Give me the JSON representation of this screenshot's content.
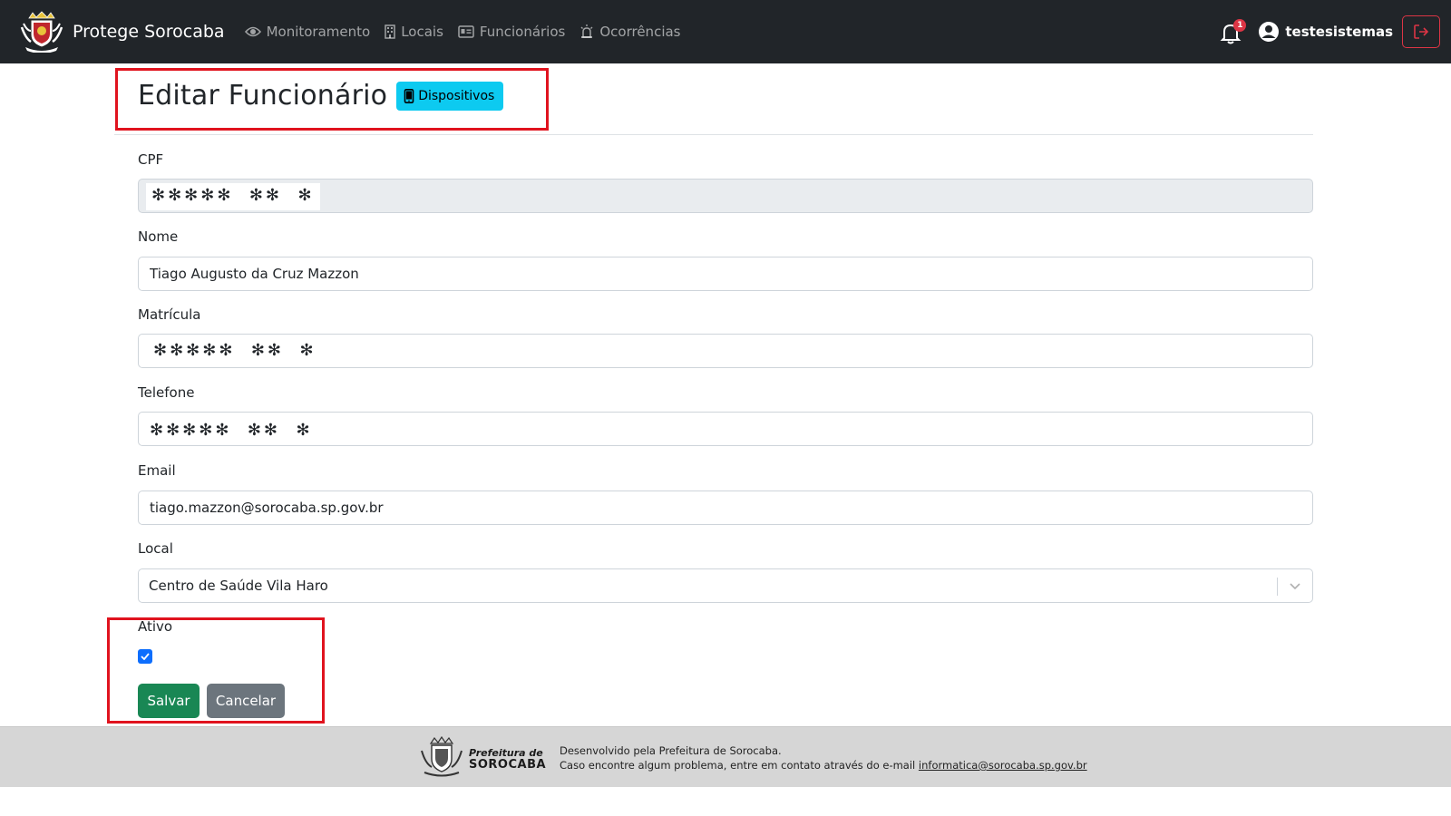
{
  "navbar": {
    "brand": "Protege Sorocaba",
    "links": [
      {
        "label": "Monitoramento",
        "icon": "eye-icon"
      },
      {
        "label": "Locais",
        "icon": "building-icon"
      },
      {
        "label": "Funcionários",
        "icon": "id-card-icon"
      },
      {
        "label": "Ocorrências",
        "icon": "siren-icon"
      }
    ],
    "notification_count": "1",
    "username": "testesistemas",
    "logout_icon": "logout-icon"
  },
  "page": {
    "title": "Editar Funcionário",
    "devices_button": "Dispositivos"
  },
  "form": {
    "cpf": {
      "label": "CPF",
      "value": "✻✻✻✻✻  ✻✻  ✻"
    },
    "nome": {
      "label": "Nome",
      "value": "Tiago Augusto da Cruz Mazzon"
    },
    "matricula": {
      "label": "Matrícula",
      "value": "✻✻✻✻✻  ✻✻  ✻"
    },
    "telefone": {
      "label": "Telefone",
      "value": "✻✻✻✻✻  ✻✻  ✻"
    },
    "email": {
      "label": "Email",
      "value": "tiago.mazzon@sorocaba.sp.gov.br"
    },
    "local": {
      "label": "Local",
      "value": "Centro de Saúde Vila Haro"
    },
    "ativo": {
      "label": "Ativo",
      "checked": true
    },
    "save_label": "Salvar",
    "cancel_label": "Cancelar"
  },
  "footer": {
    "brand_line1": "Prefeitura de",
    "brand_line2": "SOROCABA",
    "line1": "Desenvolvido pela Prefeitura de Sorocaba.",
    "line2_prefix": "Caso encontre algum problema, entre em contato através do e-mail ",
    "email": "informatica@sorocaba.sp.gov.br"
  },
  "colors": {
    "navbar": "#212529",
    "info": "#0dcaf0",
    "success": "#198754",
    "secondary": "#6c757d",
    "highlight": "#e0131e"
  }
}
